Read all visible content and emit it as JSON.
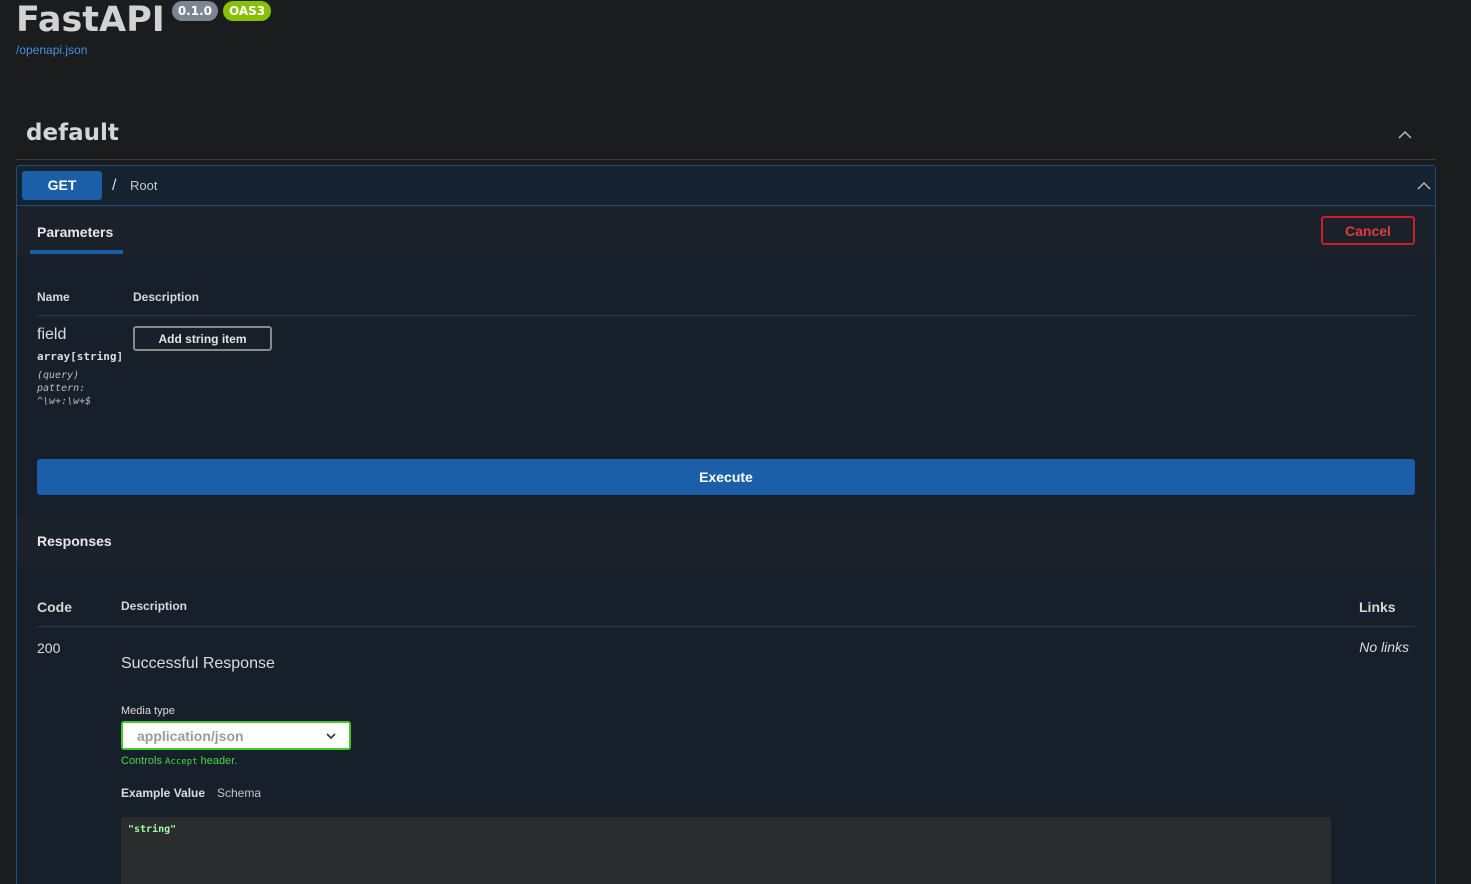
{
  "header": {
    "title": "FastAPI",
    "version_badge": "0.1.0",
    "oas_badge": "OAS3",
    "spec_link": "/openapi.json"
  },
  "tag": {
    "name": "default"
  },
  "operation": {
    "method": "GET",
    "path": "/",
    "summary": "Root",
    "parameters_tab": "Parameters",
    "cancel_label": "Cancel",
    "param_columns": [
      "Name",
      "Description"
    ],
    "param": {
      "name": "field",
      "type": "array[string]",
      "location": "(query)",
      "pattern_label": "pattern:",
      "pattern": "^\\w+:\\w+$",
      "add_item_label": "Add string item"
    },
    "execute_label": "Execute",
    "responses": {
      "title": "Responses",
      "columns": [
        "Code",
        "Description",
        "Links"
      ],
      "code": "200",
      "description": "Successful Response",
      "links": "No links",
      "media_type_label": "Media type",
      "media_type_value": "application/json",
      "controls_prefix": "Controls",
      "controls_code": "Accept",
      "controls_suffix": "header.",
      "example_tab": "Example Value",
      "schema_tab": "Schema",
      "example_code": "\"string\""
    }
  },
  "colors": {
    "get_method": "#1a5fa8",
    "cancel": "#c8202a",
    "version_badge": "#7d8492",
    "oas_badge": "#89bf04",
    "media_border": "#41c92f"
  }
}
